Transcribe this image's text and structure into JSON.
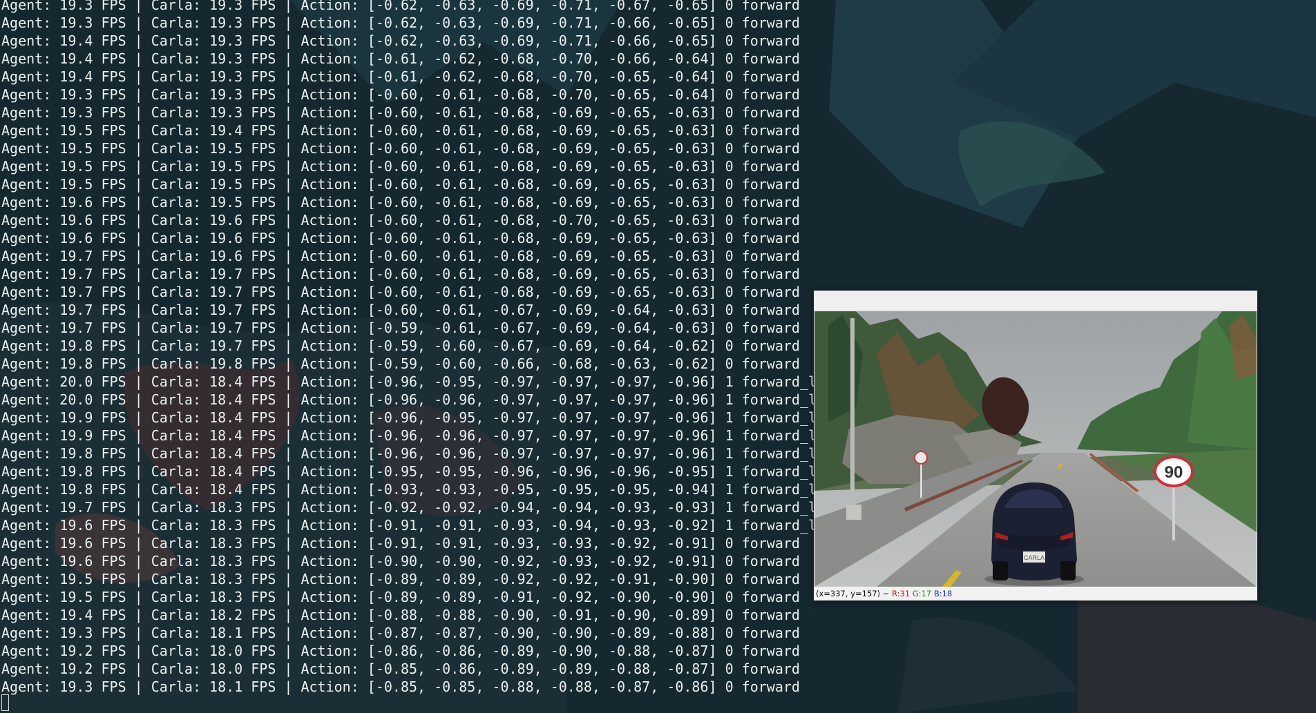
{
  "terminal": {
    "lines": [
      "Agent: 19.3 FPS | Carla: 19.3 FPS | Action: [-0.62, -0.63, -0.69, -0.71, -0.67, -0.65] 0 forward",
      "Agent: 19.3 FPS | Carla: 19.3 FPS | Action: [-0.62, -0.63, -0.69, -0.71, -0.66, -0.65] 0 forward",
      "Agent: 19.4 FPS | Carla: 19.3 FPS | Action: [-0.62, -0.63, -0.69, -0.71, -0.66, -0.65] 0 forward",
      "Agent: 19.4 FPS | Carla: 19.3 FPS | Action: [-0.61, -0.62, -0.68, -0.70, -0.66, -0.64] 0 forward",
      "Agent: 19.4 FPS | Carla: 19.3 FPS | Action: [-0.61, -0.62, -0.68, -0.70, -0.65, -0.64] 0 forward",
      "Agent: 19.3 FPS | Carla: 19.3 FPS | Action: [-0.60, -0.61, -0.68, -0.70, -0.65, -0.64] 0 forward",
      "Agent: 19.3 FPS | Carla: 19.3 FPS | Action: [-0.60, -0.61, -0.68, -0.69, -0.65, -0.63] 0 forward",
      "Agent: 19.5 FPS | Carla: 19.4 FPS | Action: [-0.60, -0.61, -0.68, -0.69, -0.65, -0.63] 0 forward",
      "Agent: 19.5 FPS | Carla: 19.5 FPS | Action: [-0.60, -0.61, -0.68, -0.69, -0.65, -0.63] 0 forward",
      "Agent: 19.5 FPS | Carla: 19.5 FPS | Action: [-0.60, -0.61, -0.68, -0.69, -0.65, -0.63] 0 forward",
      "Agent: 19.5 FPS | Carla: 19.5 FPS | Action: [-0.60, -0.61, -0.68, -0.69, -0.65, -0.63] 0 forward",
      "Agent: 19.6 FPS | Carla: 19.5 FPS | Action: [-0.60, -0.61, -0.68, -0.69, -0.65, -0.63] 0 forward",
      "Agent: 19.6 FPS | Carla: 19.6 FPS | Action: [-0.60, -0.61, -0.68, -0.70, -0.65, -0.63] 0 forward",
      "Agent: 19.6 FPS | Carla: 19.6 FPS | Action: [-0.60, -0.61, -0.68, -0.69, -0.65, -0.63] 0 forward",
      "Agent: 19.7 FPS | Carla: 19.6 FPS | Action: [-0.60, -0.61, -0.68, -0.69, -0.65, -0.63] 0 forward",
      "Agent: 19.7 FPS | Carla: 19.7 FPS | Action: [-0.60, -0.61, -0.68, -0.69, -0.65, -0.63] 0 forward",
      "Agent: 19.7 FPS | Carla: 19.7 FPS | Action: [-0.60, -0.61, -0.68, -0.69, -0.65, -0.63] 0 forward",
      "Agent: 19.7 FPS | Carla: 19.7 FPS | Action: [-0.60, -0.61, -0.67, -0.69, -0.64, -0.63] 0 forward",
      "Agent: 19.7 FPS | Carla: 19.7 FPS | Action: [-0.59, -0.61, -0.67, -0.69, -0.64, -0.63] 0 forward",
      "Agent: 19.8 FPS | Carla: 19.7 FPS | Action: [-0.59, -0.60, -0.67, -0.69, -0.64, -0.62] 0 forward",
      "Agent: 19.8 FPS | Carla: 19.8 FPS | Action: [-0.59, -0.60, -0.66, -0.68, -0.63, -0.62] 0 forward",
      "Agent: 20.0 FPS | Carla: 18.4 FPS | Action: [-0.96, -0.95, -0.97, -0.97, -0.97, -0.96] 1 forward_l",
      "Agent: 20.0 FPS | Carla: 18.4 FPS | Action: [-0.96, -0.96, -0.97, -0.97, -0.97, -0.96] 1 forward_l",
      "Agent: 19.9 FPS | Carla: 18.4 FPS | Action: [-0.96, -0.95, -0.97, -0.97, -0.97, -0.96] 1 forward_l",
      "Agent: 19.9 FPS | Carla: 18.4 FPS | Action: [-0.96, -0.96, -0.97, -0.97, -0.97, -0.96] 1 forward_l",
      "Agent: 19.8 FPS | Carla: 18.4 FPS | Action: [-0.96, -0.96, -0.97, -0.97, -0.97, -0.96] 1 forward_l",
      "Agent: 19.8 FPS | Carla: 18.4 FPS | Action: [-0.95, -0.95, -0.96, -0.96, -0.96, -0.95] 1 forward_l",
      "Agent: 19.8 FPS | Carla: 18.4 FPS | Action: [-0.93, -0.93, -0.95, -0.95, -0.95, -0.94] 1 forward_l",
      "Agent: 19.7 FPS | Carla: 18.3 FPS | Action: [-0.92, -0.92, -0.94, -0.94, -0.93, -0.93] 1 forward_l",
      "Agent: 19.6 FPS | Carla: 18.3 FPS | Action: [-0.91, -0.91, -0.93, -0.94, -0.93, -0.92] 1 forward_l",
      "Agent: 19.6 FPS | Carla: 18.3 FPS | Action: [-0.91, -0.91, -0.93, -0.93, -0.92, -0.91] 0 forward",
      "Agent: 19.6 FPS | Carla: 18.3 FPS | Action: [-0.90, -0.90, -0.92, -0.93, -0.92, -0.91] 0 forward",
      "Agent: 19.5 FPS | Carla: 18.3 FPS | Action: [-0.89, -0.89, -0.92, -0.92, -0.91, -0.90] 0 forward",
      "Agent: 19.5 FPS | Carla: 18.3 FPS | Action: [-0.89, -0.89, -0.91, -0.92, -0.90, -0.90] 0 forward",
      "Agent: 19.4 FPS | Carla: 18.2 FPS | Action: [-0.88, -0.88, -0.90, -0.91, -0.90, -0.89] 0 forward",
      "Agent: 19.3 FPS | Carla: 18.1 FPS | Action: [-0.87, -0.87, -0.90, -0.90, -0.89, -0.88] 0 forward",
      "Agent: 19.2 FPS | Carla: 18.0 FPS | Action: [-0.86, -0.86, -0.89, -0.90, -0.88, -0.87] 0 forward",
      "Agent: 19.2 FPS | Carla: 18.0 FPS | Action: [-0.85, -0.86, -0.89, -0.89, -0.88, -0.87] 0 forward",
      "Agent: 19.3 FPS | Carla: 18.1 FPS | Action: [-0.85, -0.85, -0.88, -0.88, -0.87, -0.86] 0 forward"
    ]
  },
  "viewer": {
    "speed_sign": "90",
    "plate": "CARLA",
    "status": {
      "coords": "(x=337, y=157) ~ ",
      "r": "R:31",
      "g": "G:17",
      "b": "B:18"
    }
  },
  "colors": {
    "terminal_text": "#eaf0f2",
    "background": "#132530",
    "status_red": "#d21414",
    "status_green": "#169016",
    "status_blue": "#1a2fd6"
  }
}
